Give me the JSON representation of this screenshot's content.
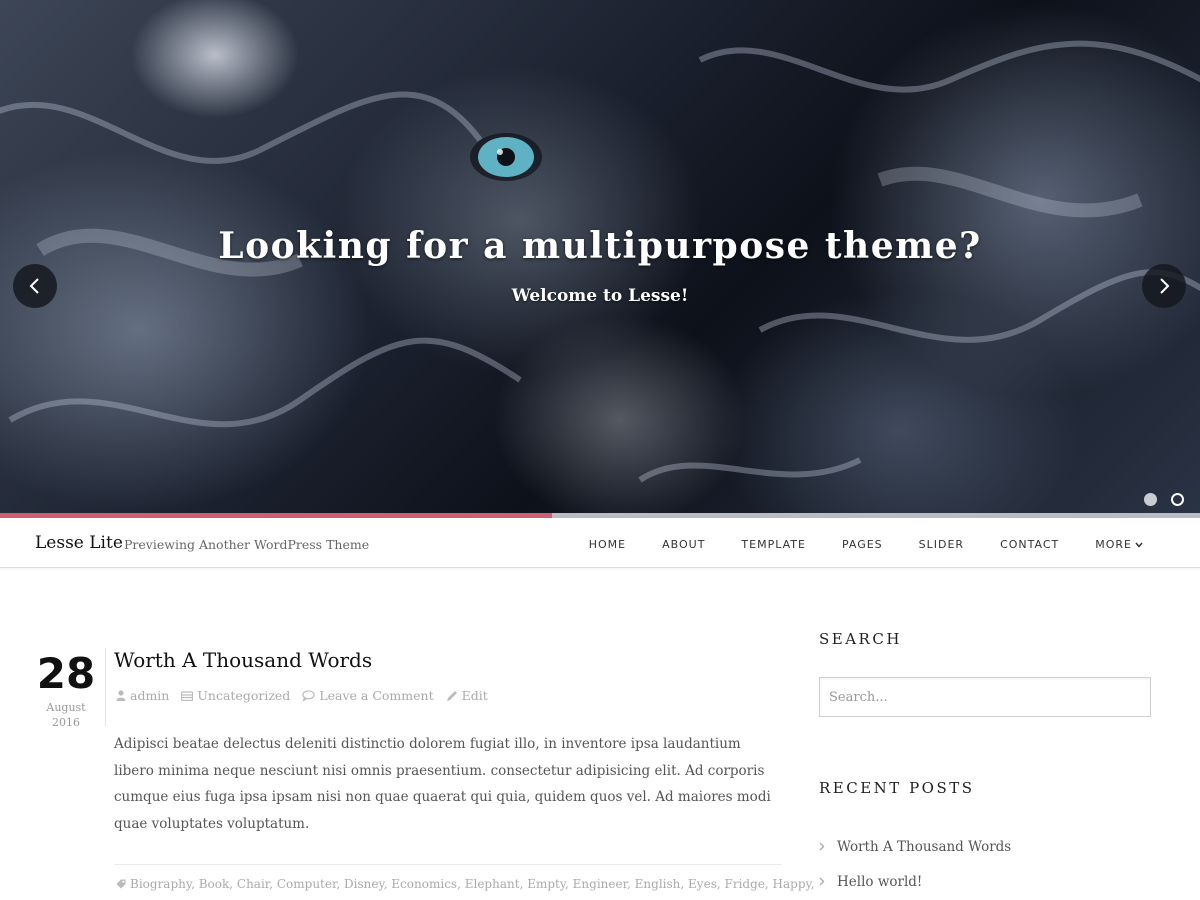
{
  "slider": {
    "title": "Looking for a multipurpose theme?",
    "subtitle": "Welcome to Lesse!",
    "progress": 0.46,
    "active_slide": 1,
    "slide_count": 2
  },
  "header": {
    "site_title": "Lesse Lite",
    "site_description": "Previewing Another WordPress Theme",
    "nav": [
      "HOME",
      "ABOUT",
      "TEMPLATE",
      "PAGES",
      "SLIDER",
      "CONTACT",
      "MORE"
    ]
  },
  "post": {
    "day": "28",
    "month": "August",
    "year": "2016",
    "title": "Worth A Thousand Words",
    "author": "admin",
    "category": "Uncategorized",
    "comment_link": "Leave a Comment",
    "edit_link": "Edit",
    "excerpt": "Adipisci beatae delectus deleniti distinctio dolorem fugiat illo, in inventore ipsa laudantium libero minima neque nesciunt nisi omnis praesentium. consectetur adipisicing elit. Ad corporis cumque eius fuga ipsa ipsam nisi non quae quaerat qui quia, quidem quos vel. Ad maiores modi quae voluptates voluptatum.",
    "tags": [
      "Biography",
      "Book",
      "Chair",
      "Computer",
      "Disney",
      "Economics",
      "Elephant",
      "Empty",
      "Engineer",
      "English",
      "Eyes",
      "Fridge",
      "Happy"
    ]
  },
  "sidebar": {
    "search_title": "SEARCH",
    "search_placeholder": "Search...",
    "recent_title": "RECENT POSTS",
    "recent_posts": [
      "Worth A Thousand Words",
      "Hello world!"
    ]
  },
  "colors": {
    "accent": "#cf5f70",
    "progress_track": "#b9bcc3"
  }
}
